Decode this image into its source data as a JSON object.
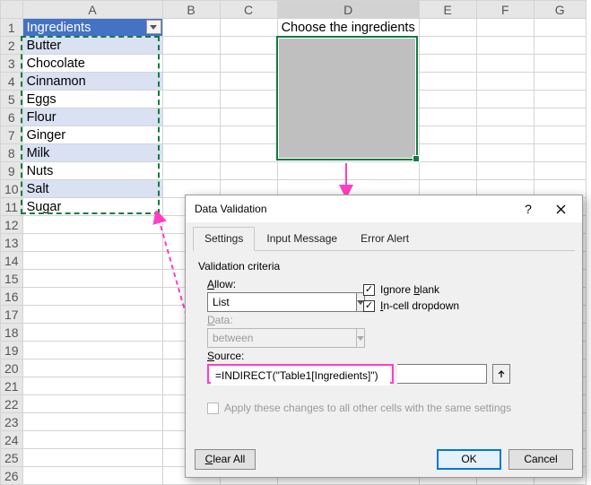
{
  "columns": [
    "A",
    "B",
    "C",
    "D",
    "E",
    "F",
    "G"
  ],
  "header": {
    "a1": "Ingredients",
    "d1": "Choose the ingredients"
  },
  "ingredients": [
    "Butter",
    "Chocolate",
    "Cinnamon",
    "Eggs",
    "Flour",
    "Ginger",
    "Milk",
    "Nuts",
    "Salt",
    "Sugar"
  ],
  "dialog": {
    "title": "Data Validation",
    "tabs": {
      "settings": "Settings",
      "input": "Input Message",
      "error": "Error Alert"
    },
    "criteria_label": "Validation criteria",
    "allow_label": "Allow:",
    "allow_value": "List",
    "data_label": "Data:",
    "data_value": "between",
    "ignore_blank": "Ignore blank",
    "incell_dropdown": "In-cell dropdown",
    "source_label": "Source:",
    "source_value": "=INDIRECT(\"Table1[Ingredients]\")",
    "apply_label": "Apply these changes to all other cells with the same settings",
    "clear": "Clear All",
    "ok": "OK",
    "cancel": "Cancel",
    "help": "?"
  }
}
